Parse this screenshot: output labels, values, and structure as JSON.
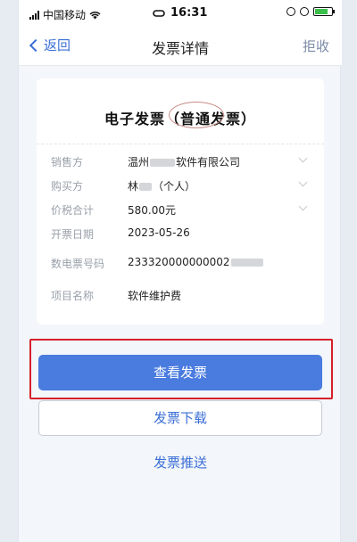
{
  "status_bar": {
    "carrier": "中国移动",
    "time": "16:31"
  },
  "nav": {
    "back_label": "返回",
    "title": "发票详情",
    "reject_label": "拒收"
  },
  "invoice": {
    "title": "电子发票（普通发票）",
    "fields": [
      {
        "label": "销售方",
        "value_prefix": "温州",
        "value_suffix": "软件有限公司"
      },
      {
        "label": "购买方",
        "value_prefix": "林",
        "value_suffix": "（个人）"
      },
      {
        "label": "价税合计",
        "value": "580.00元"
      },
      {
        "label": "开票日期",
        "value": "2023-05-26"
      },
      {
        "label": "数电票号码",
        "value": "233320000000002"
      },
      {
        "label": "项目名称",
        "value": "软件维护费"
      }
    ]
  },
  "actions": {
    "view_label": "查看发票",
    "download_label": "发票下载",
    "push_label": "发票推送"
  },
  "colors": {
    "accent": "#4a7bdf",
    "highlight": "#d6202a"
  }
}
